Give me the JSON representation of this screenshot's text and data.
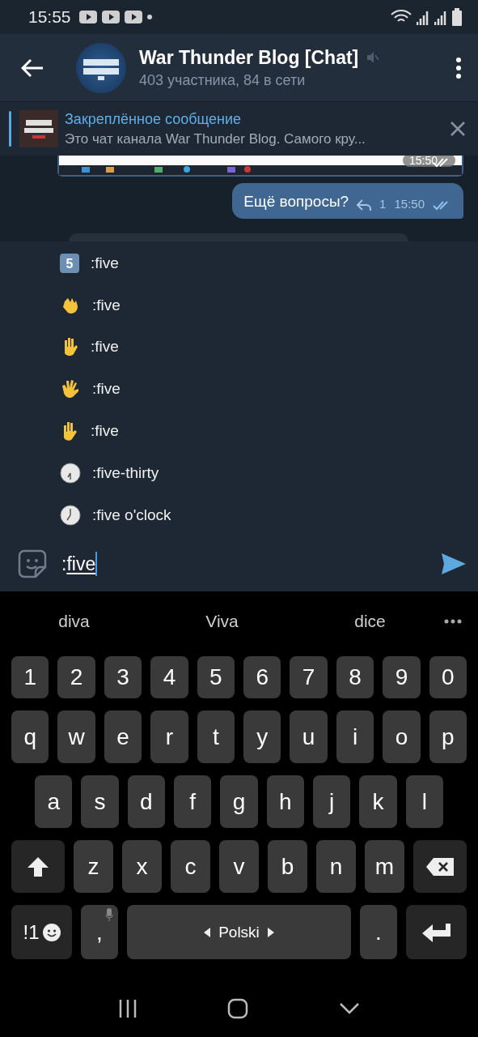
{
  "status_bar": {
    "time": "15:55"
  },
  "header": {
    "title": "War Thunder Blog [Chat]",
    "muted": true,
    "subtitle": "403 участника, 84 в сети"
  },
  "pinned": {
    "title": "Закреплённое сообщение",
    "text": "Это чат канала War Thunder Blog. Самого кру..."
  },
  "messages": [
    {
      "kind": "picture",
      "time": "15:50",
      "read": true
    },
    {
      "kind": "text",
      "text": "Ещё вопросы?",
      "replies": "1",
      "time": "15:50",
      "read": true
    }
  ],
  "emoji_suggestions": [
    {
      "kind": "keycap",
      "glyph": "5",
      "label": ":five"
    },
    {
      "kind": "wave",
      "label": ":five"
    },
    {
      "kind": "raised-back",
      "label": ":five"
    },
    {
      "kind": "splayed",
      "label": ":five"
    },
    {
      "kind": "raised",
      "label": ":five"
    },
    {
      "kind": "clock-half",
      "label": ":five-thirty"
    },
    {
      "kind": "clock",
      "label": ":five o'clock"
    }
  ],
  "input": {
    "prefix": ":",
    "composing": "five"
  },
  "keyboard": {
    "suggestions": [
      "diva",
      "Viva",
      "dice"
    ],
    "rows": [
      [
        {
          "kind": "char",
          "label": "1"
        },
        {
          "kind": "char",
          "label": "2"
        },
        {
          "kind": "char",
          "label": "3"
        },
        {
          "kind": "char",
          "label": "4"
        },
        {
          "kind": "char",
          "label": "5"
        },
        {
          "kind": "char",
          "label": "6"
        },
        {
          "kind": "char",
          "label": "7"
        },
        {
          "kind": "char",
          "label": "8"
        },
        {
          "kind": "char",
          "label": "9"
        },
        {
          "kind": "char",
          "label": "0"
        }
      ],
      [
        {
          "kind": "char",
          "label": "q"
        },
        {
          "kind": "char",
          "label": "w"
        },
        {
          "kind": "char",
          "label": "e"
        },
        {
          "kind": "char",
          "label": "r"
        },
        {
          "kind": "char",
          "label": "t"
        },
        {
          "kind": "char",
          "label": "y"
        },
        {
          "kind": "char",
          "label": "u"
        },
        {
          "kind": "char",
          "label": "i"
        },
        {
          "kind": "char",
          "label": "o"
        },
        {
          "kind": "char",
          "label": "p"
        }
      ],
      [
        {
          "kind": "char",
          "label": "a"
        },
        {
          "kind": "char",
          "label": "s"
        },
        {
          "kind": "char",
          "label": "d"
        },
        {
          "kind": "char",
          "label": "f"
        },
        {
          "kind": "char",
          "label": "g"
        },
        {
          "kind": "char",
          "label": "h"
        },
        {
          "kind": "char",
          "label": "j"
        },
        {
          "kind": "char",
          "label": "k"
        },
        {
          "kind": "char",
          "label": "l"
        }
      ],
      [
        {
          "kind": "shift"
        },
        {
          "kind": "char",
          "label": "z"
        },
        {
          "kind": "char",
          "label": "x"
        },
        {
          "kind": "char",
          "label": "c"
        },
        {
          "kind": "char",
          "label": "v"
        },
        {
          "kind": "char",
          "label": "b"
        },
        {
          "kind": "char",
          "label": "n"
        },
        {
          "kind": "char",
          "label": "m"
        },
        {
          "kind": "backspace"
        }
      ],
      [
        {
          "kind": "symbols",
          "label": "!1"
        },
        {
          "kind": "comma",
          "label": ","
        },
        {
          "kind": "space",
          "label": "Polski"
        },
        {
          "kind": "period",
          "label": "."
        },
        {
          "kind": "enter"
        }
      ]
    ]
  }
}
